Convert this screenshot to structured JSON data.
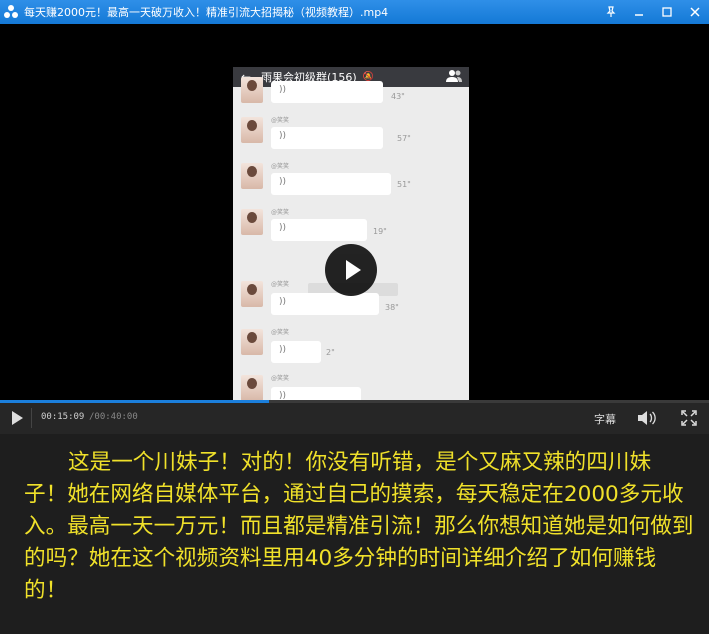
{
  "window": {
    "title": "每天赚2000元！最高一天破万收入！精准引流大招揭秘（视频教程）.mp4",
    "pin_icon": "pin-icon",
    "minimize_icon": "minimize-icon",
    "maximize_icon": "maximize-icon",
    "close_icon": "close-icon",
    "accent_color": "#1479d6"
  },
  "video": {
    "chat": {
      "title": "雨果会初级群(156)",
      "back_icon": "back-arrow-icon",
      "mute_icon": "mute-icon",
      "members_icon": "group-members-icon",
      "messages": [
        {
          "sender": "",
          "duration": "43\""
        },
        {
          "sender": "@笑笑",
          "duration": "57\""
        },
        {
          "sender": "@笑笑",
          "duration": "51\""
        },
        {
          "sender": "@笑笑",
          "duration": "19\""
        },
        {
          "sender": "@笑笑",
          "duration": "38\""
        },
        {
          "sender": "@笑笑",
          "duration": "2\""
        },
        {
          "sender": "@笑笑",
          "duration": ""
        }
      ]
    },
    "play_icon": "play-icon"
  },
  "controls": {
    "current_time": "00:15:09",
    "total_time": "/00:40:00",
    "progress": 0.379,
    "subtitle_label": "字幕",
    "volume_icon": "volume-icon",
    "fullscreen_icon": "fullscreen-icon"
  },
  "caption": {
    "text": "这是一个川妹子！对的！你没有听错，是个又麻又辣的四川妹子！她在网络自媒体平台，通过自己的摸索，每天稳定在2000多元收入。最高一天一万元！而且都是精准引流！那么你想知道她是如何做到的吗？她在这个视频资料里用40多分钟的时间详细介绍了如何赚钱的！",
    "color": "#f0e12a"
  }
}
